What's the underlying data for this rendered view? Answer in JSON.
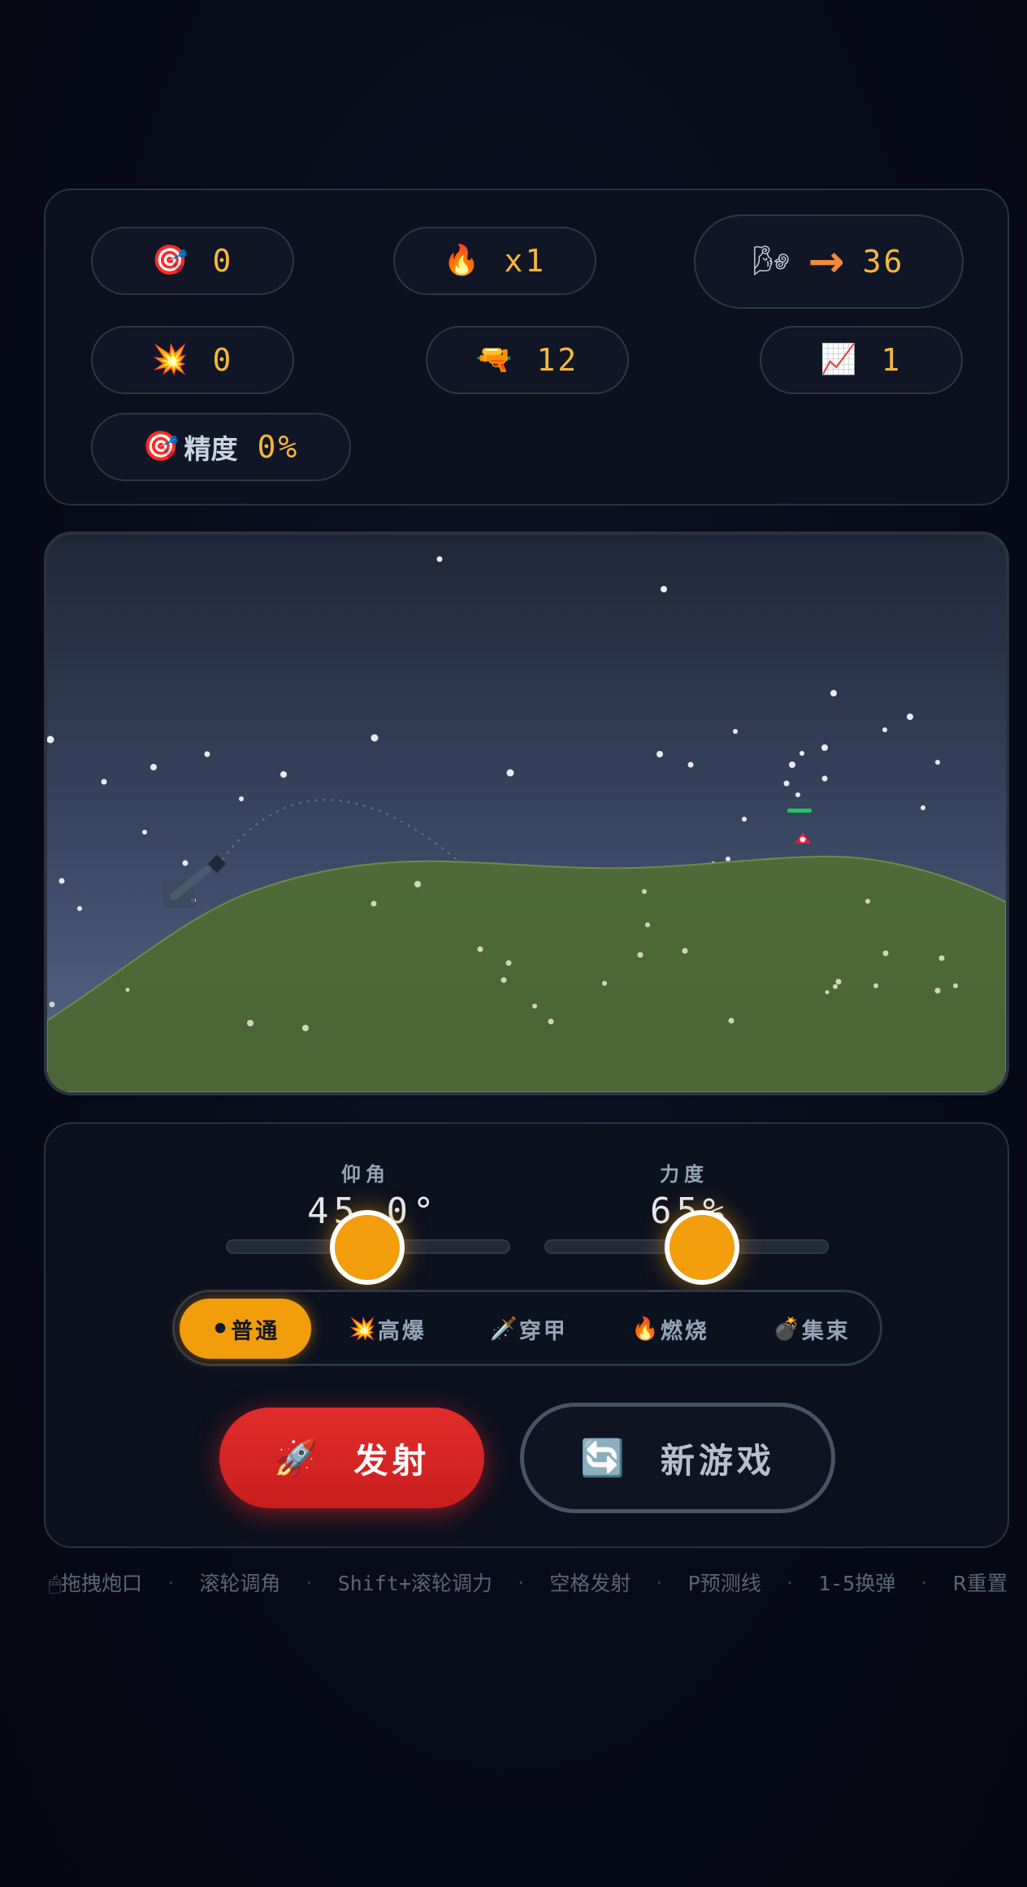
{
  "stats": {
    "targets": {
      "icon": "🎯",
      "icon_name": "target-icon",
      "value": "0"
    },
    "combo": {
      "icon": "🔥",
      "icon_name": "fire-icon",
      "value": "x1"
    },
    "wind": {
      "icon": "🌬",
      "icon_name": "wind-icon",
      "arrow": "→",
      "value": "36"
    },
    "hits": {
      "icon": "💥",
      "icon_name": "explosion-icon",
      "value": "0"
    },
    "ammo": {
      "icon": "🔫",
      "icon_name": "gun-icon",
      "value": "12"
    },
    "level": {
      "icon": "📈",
      "icon_name": "chart-up-icon",
      "value": "1"
    },
    "accuracy": {
      "icon": "🎯",
      "icon_name": "target-icon",
      "label": "精度",
      "value": "0%"
    }
  },
  "controls": {
    "angle": {
      "label": "仰角",
      "value": "45.0°",
      "fraction": 0.5
    },
    "power": {
      "label": "力度",
      "value": "65%",
      "fraction": 0.65
    },
    "ammo_types": [
      {
        "icon": "⚫",
        "icon_name": "black-circle-icon",
        "label": "普通",
        "active": true
      },
      {
        "icon": "💥",
        "icon_name": "explosion-icon",
        "label": "高爆",
        "active": false
      },
      {
        "icon": "🗡️",
        "icon_name": "dagger-icon",
        "label": "穿甲",
        "active": false
      },
      {
        "icon": "🔥",
        "icon_name": "fire-icon",
        "label": "燃烧",
        "active": false
      },
      {
        "icon": "💣",
        "icon_name": "bomb-icon",
        "label": "集束",
        "active": false
      }
    ],
    "fire": {
      "icon": "🚀",
      "icon_name": "rocket-icon",
      "label": "发射"
    },
    "new_game": {
      "icon": "🔄",
      "icon_name": "refresh-icon",
      "label": "新游戏"
    }
  },
  "help": {
    "items": [
      "🖱拖拽炮口",
      "滚轮调角",
      "Shift+滚轮调力",
      "空格发射",
      "P预测线",
      "1-5换弹",
      "R重置"
    ],
    "separator": "·"
  },
  "colors": {
    "accent": "#f29d0c",
    "fire": "#dc2626",
    "ground": "#4e6b3a",
    "sky_top": "#1f2638",
    "sky_bottom": "#4a5a7a",
    "enemy": "#e11d48"
  }
}
